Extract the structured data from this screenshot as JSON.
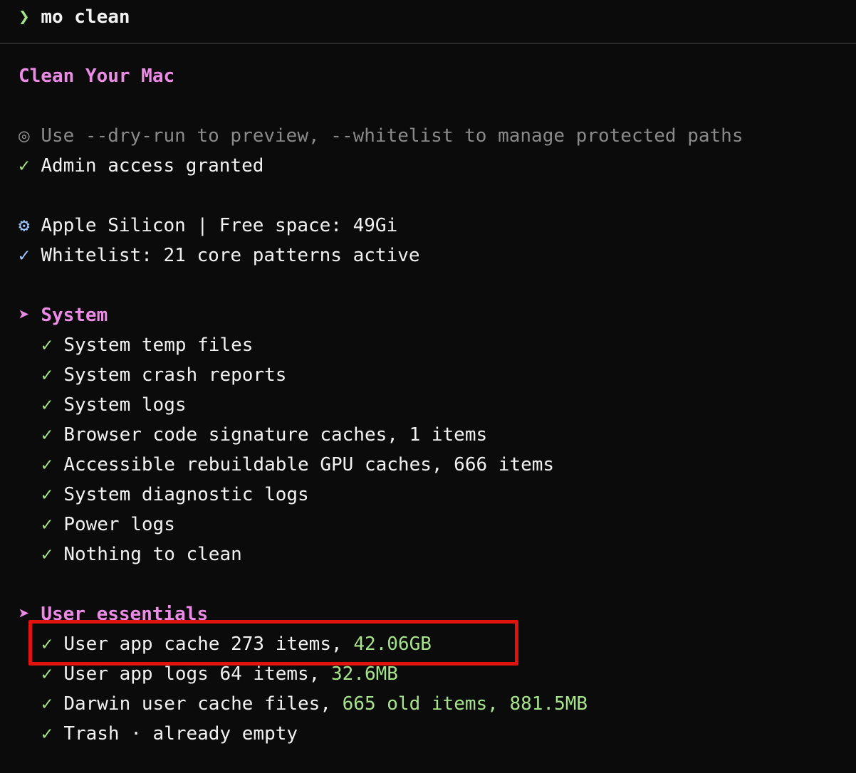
{
  "prompt": {
    "symbol": "❯",
    "command": "mo clean"
  },
  "header": {
    "title": "Clean Your Mac"
  },
  "info_lines": [
    {
      "icon": "◎",
      "text": "Use --dry-run to preview, --whitelist to manage protected paths"
    },
    {
      "icon": "✓",
      "text": "Admin access granted"
    }
  ],
  "system_info": [
    {
      "icon": "⚙",
      "text": "Apple Silicon | Free space: 49Gi"
    },
    {
      "icon": "✓",
      "text": "Whitelist: 21 core patterns active"
    }
  ],
  "sections": {
    "system": {
      "arrow": "➤",
      "title": "System",
      "items": [
        {
          "icon": "✓",
          "text": "System temp files"
        },
        {
          "icon": "✓",
          "text": "System crash reports"
        },
        {
          "icon": "✓",
          "text": "System logs"
        },
        {
          "icon": "✓",
          "text": "Browser code signature caches, 1 items"
        },
        {
          "icon": "✓",
          "text": "Accessible rebuildable GPU caches, 666 items"
        },
        {
          "icon": "✓",
          "text": "System diagnostic logs"
        },
        {
          "icon": "✓",
          "text": "Power logs"
        },
        {
          "icon": "✓",
          "text": "Nothing to clean"
        }
      ]
    },
    "user_essentials": {
      "arrow": "➤",
      "title": "User essentials",
      "items": [
        {
          "icon": "✓",
          "text": "User app cache 273 items, ",
          "highlight": "42.06GB"
        },
        {
          "icon": "✓",
          "text": "User app logs 64 items, ",
          "highlight": "32.6MB"
        },
        {
          "icon": "✓",
          "text": "Darwin user cache files, ",
          "highlight": "665 old items, 881.5MB"
        },
        {
          "icon": "✓",
          "text": "Trash · already empty",
          "highlight": ""
        }
      ]
    }
  },
  "colors": {
    "background": "#0b0b0c",
    "accent_pink": "#ec8be6",
    "success_green": "#a6e38a",
    "annotation_red": "#e0130f"
  }
}
